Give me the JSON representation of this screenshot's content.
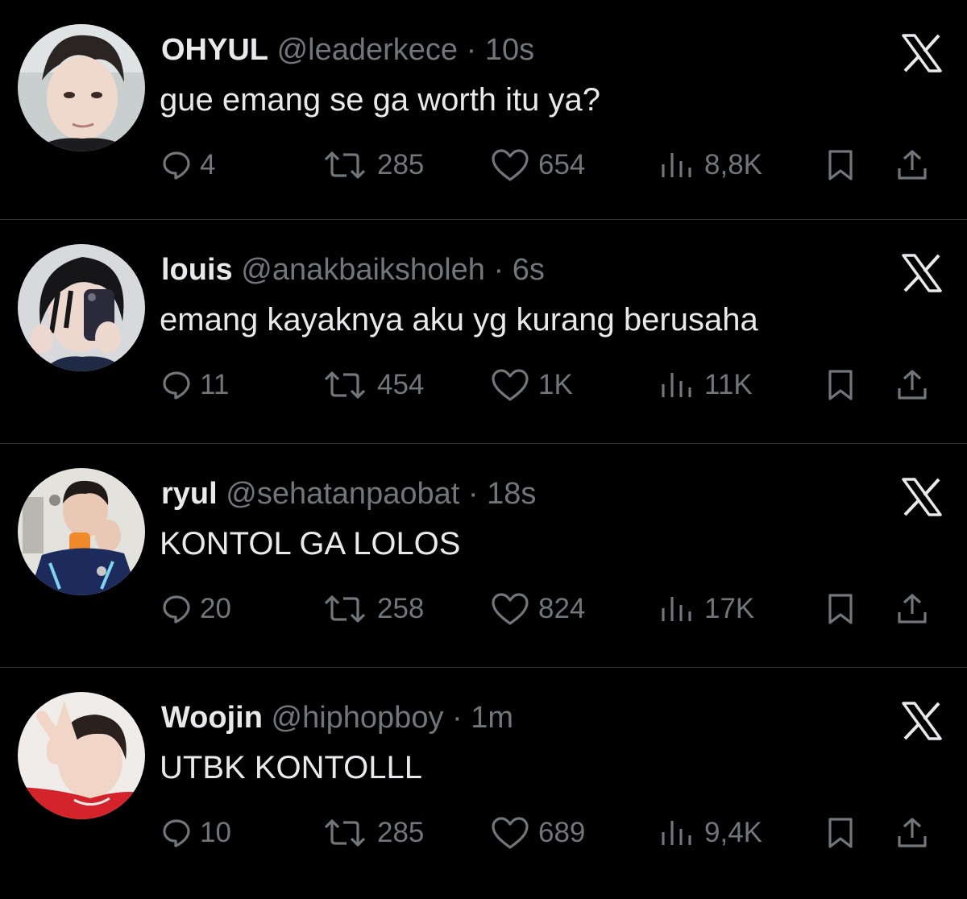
{
  "tweets": [
    {
      "display_name": "OHYUL",
      "handle": "@leaderkece",
      "separator": "·",
      "time": "10s",
      "text": "gue emang se ga worth itu ya?",
      "replies": "4",
      "retweets": "285",
      "likes": "654",
      "views": "8,8K"
    },
    {
      "display_name": "louis",
      "handle": "@anakbaiksholeh",
      "separator": "·",
      "time": "6s",
      "text": "emang kayaknya aku yg kurang berusaha",
      "replies": "11",
      "retweets": "454",
      "likes": "1K",
      "views": "11K"
    },
    {
      "display_name": "ryul",
      "handle": "@sehatanpaobat",
      "separator": "·",
      "time": "18s",
      "text": "KONTOL GA LOLOS",
      "replies": "20",
      "retweets": "258",
      "likes": "824",
      "views": "17K"
    },
    {
      "display_name": "Woojin",
      "handle": "@hiphopboy",
      "separator": "·",
      "time": "1m",
      "text": "UTBK KONTOLLL",
      "replies": "10",
      "retweets": "285",
      "likes": "689",
      "views": "9,4K"
    }
  ],
  "icons": {
    "reply": "speech-bubble-icon",
    "retweet": "retweet-arrows-icon",
    "like": "heart-icon",
    "views": "bar-chart-icon",
    "bookmark": "bookmark-icon",
    "share": "share-upload-icon",
    "brand": "x-logo-icon"
  },
  "colors": {
    "background": "#000000",
    "primary_text": "#e7e9ea",
    "secondary_text": "#71767b",
    "divider": "#2f3336"
  }
}
